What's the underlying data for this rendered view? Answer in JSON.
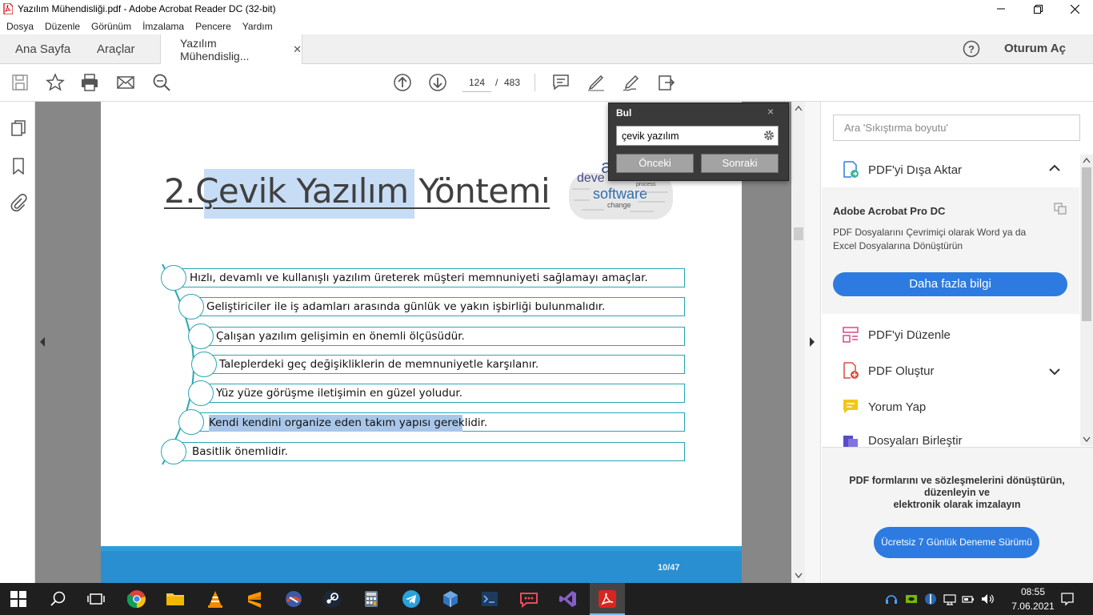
{
  "window": {
    "title": "Yazılım Mühendisliği.pdf - Adobe Acrobat Reader DC (32-bit)"
  },
  "menu": [
    "Dosya",
    "Düzenle",
    "Görünüm",
    "İmzalama",
    "Pencere",
    "Yardım"
  ],
  "tabs": {
    "home": "Ana Sayfa",
    "tools": "Araçlar",
    "document": "Yazılım Mühendislig...",
    "signin": "Oturum Aç"
  },
  "toolbar": {
    "current_page": "124",
    "separator": "/",
    "total_pages": "483"
  },
  "slide": {
    "title_prefix": "2.",
    "title_match": "Çevik Yazılım",
    "title_rest": " Yöntemi",
    "bullets": [
      "Hızlı, devamlı ve kullanışlı yazılım üreterek müşteri memnuniyeti sağlamayı amaçlar.",
      "Geliştiriciler ile iş adamları arasında günlük ve yakın işbirliği bulunmalıdır.",
      "Çalışan yazılım gelişimin en önemli ölçüsüdür.",
      "Taleplerdeki geç değişikliklerin de memnuniyetle karşılanır.",
      "Yüz yüze görüşme iletişimin en güzel yoludur.",
      "Kendi kendini organize eden takım yapısı gereklidir.",
      "Basitlik önemlidir."
    ],
    "wordcloud": [
      "a",
      "deve",
      "software",
      "change",
      "process",
      "t"
    ],
    "footer_page": "10/47"
  },
  "find": {
    "title": "Bul",
    "close": "×",
    "query": "çevik yazılım",
    "prev": "Önceki",
    "next": "Sonraki"
  },
  "right_panel": {
    "search_placeholder": "Ara 'Sıkıştırma boyutu'",
    "export": {
      "label": "PDF'yi Dışa Aktar",
      "product": "Adobe Acrobat Pro DC",
      "description": "PDF Dosyalarını Çevrimiçi olarak Word ya da Excel Dosyalarına Dönüştürün",
      "button": "Daha fazla bilgi"
    },
    "tools": [
      "PDF'yi Düzenle",
      "PDF Oluştur",
      "Yorum Yap",
      "Dosyaları Birleştir"
    ],
    "promo_line1": "PDF formlarını ve sözleşmelerini dönüştürün, düzenleyin ve",
    "promo_line2": "elektronik olarak imzalayın",
    "trial_button": "Ücretsiz 7 Günlük Deneme Sürümü"
  },
  "taskbar": {
    "time": "08:55",
    "date": "7.06.2021"
  },
  "colors": {
    "accent": "#2d7be0",
    "teal": "#2aa6b4",
    "highlight": "#c7dcf5",
    "find_bg": "#3a3a3a"
  }
}
